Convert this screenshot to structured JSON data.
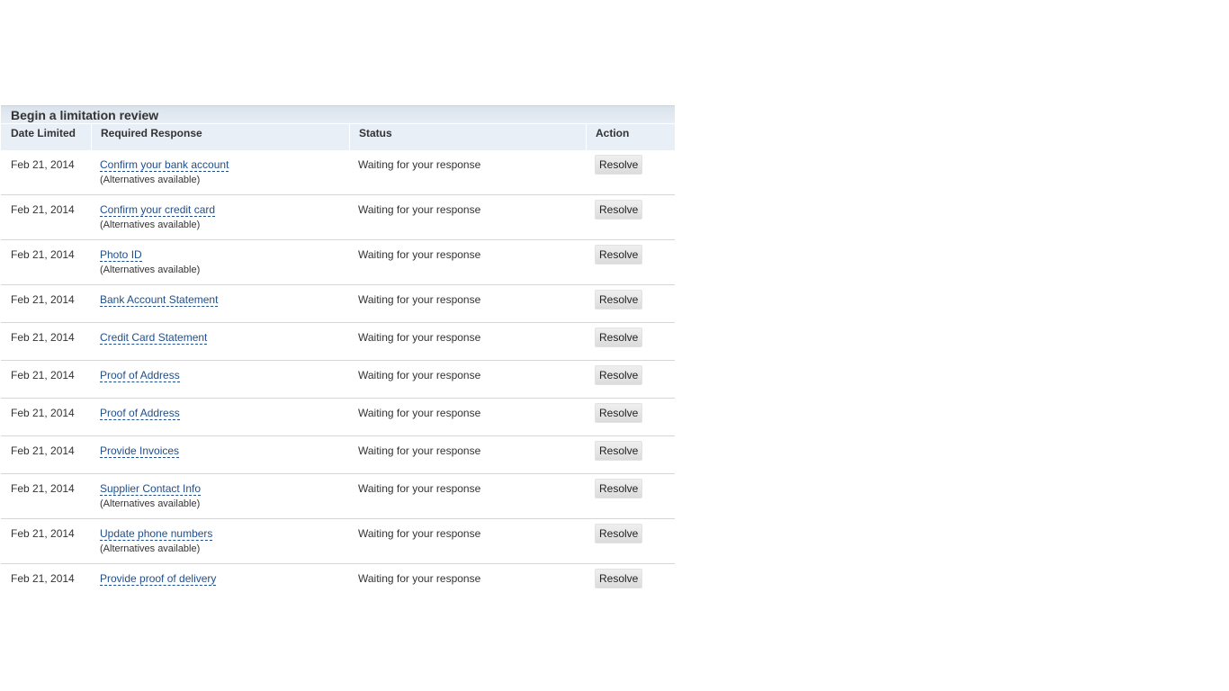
{
  "panel": {
    "title": "Begin a limitation review",
    "columns": {
      "date": "Date Limited",
      "response": "Required Response",
      "status": "Status",
      "action": "Action"
    },
    "rows": [
      {
        "date": "Feb 21, 2014",
        "response": "Confirm your bank account",
        "note": "(Alternatives available)",
        "status": "Waiting for your response",
        "action": "Resolve"
      },
      {
        "date": "Feb 21, 2014",
        "response": "Confirm your credit card",
        "note": "(Alternatives available)",
        "status": "Waiting for your response",
        "action": "Resolve"
      },
      {
        "date": "Feb 21, 2014",
        "response": "Photo ID",
        "note": "(Alternatives available)",
        "status": "Waiting for your response",
        "action": "Resolve"
      },
      {
        "date": "Feb 21, 2014",
        "response": "Bank Account Statement",
        "note": "",
        "status": "Waiting for your response",
        "action": "Resolve"
      },
      {
        "date": "Feb 21, 2014",
        "response": "Credit Card Statement",
        "note": "",
        "status": "Waiting for your response",
        "action": "Resolve"
      },
      {
        "date": "Feb 21, 2014",
        "response": "Proof of Address",
        "note": "",
        "status": "Waiting for your response",
        "action": "Resolve"
      },
      {
        "date": "Feb 21, 2014",
        "response": "Proof of Address",
        "note": "",
        "status": "Waiting for your response",
        "action": "Resolve"
      },
      {
        "date": "Feb 21, 2014",
        "response": "Provide Invoices",
        "note": "",
        "status": "Waiting for your response",
        "action": "Resolve"
      },
      {
        "date": "Feb 21, 2014",
        "response": "Supplier Contact Info",
        "note": "(Alternatives available)",
        "status": "Waiting for your response",
        "action": "Resolve"
      },
      {
        "date": "Feb 21, 2014",
        "response": "Update phone numbers",
        "note": "(Alternatives available)",
        "status": "Waiting for your response",
        "action": "Resolve"
      },
      {
        "date": "Feb 21, 2014",
        "response": "Provide proof of delivery",
        "note": "",
        "status": "Waiting for your response",
        "action": "Resolve"
      }
    ]
  }
}
